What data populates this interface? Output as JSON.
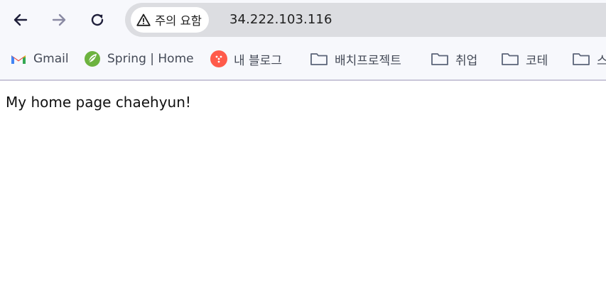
{
  "toolbar": {
    "back_icon": "arrow-left-icon",
    "forward_icon": "arrow-right-icon",
    "reload_icon": "reload-icon"
  },
  "omnibox": {
    "security_label": "주의 요함",
    "security_icon": "warning-triangle-icon",
    "url": "34.222.103.116"
  },
  "bookmarks": {
    "items": [
      {
        "label": "Gmail",
        "icon": "gmail-icon"
      },
      {
        "label": "Spring | Home",
        "icon": "spring-icon"
      },
      {
        "label": "내 블로그",
        "icon": "blog-icon"
      },
      {
        "label": "배치프로젝트",
        "icon": "folder-icon"
      },
      {
        "label": "취업",
        "icon": "folder-icon"
      },
      {
        "label": "코테",
        "icon": "folder-icon"
      },
      {
        "label": "스",
        "icon": "folder-icon"
      }
    ]
  },
  "page": {
    "text": "My home page chaehyun!"
  },
  "colors": {
    "toolbar_bg": "#f7f8fc",
    "omnibox_bg": "#dcdde1",
    "page_bg": "#ffffff",
    "icon_color": "#1f1f3a"
  }
}
